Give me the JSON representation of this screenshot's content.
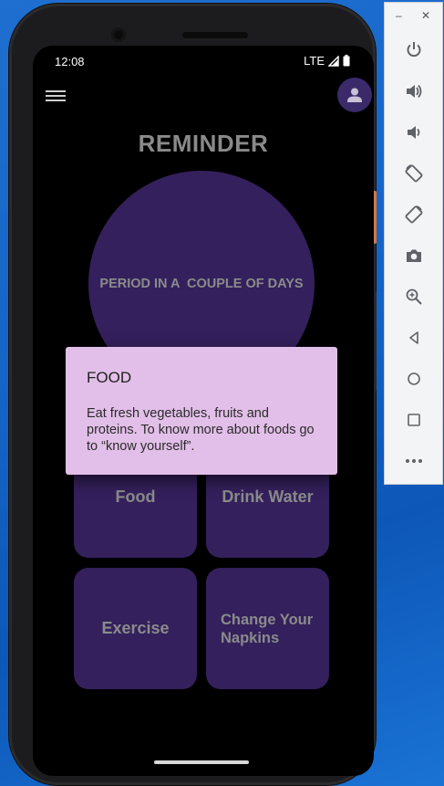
{
  "status_bar": {
    "time": "12:08",
    "network": "LTE"
  },
  "app": {
    "title": "REMINDER",
    "circle_text": "PERIOD IN A  COUPLE OF DAYS",
    "tiles": [
      {
        "label": "Food"
      },
      {
        "label": "Drink Water"
      },
      {
        "label": "Exercise"
      },
      {
        "label": "Change Your\nNapkins"
      }
    ]
  },
  "dialog": {
    "title": "FOOD",
    "body": "Eat fresh vegetables, fruits and proteins. To know more about foods go to “know yourself”."
  },
  "toolbar": {
    "minimize_label": "–",
    "close_label": "✕",
    "buttons": [
      "power-icon",
      "volume-up-icon",
      "volume-down-icon",
      "rotate-left-icon",
      "rotate-right-icon",
      "camera-icon",
      "zoom-icon",
      "back-icon",
      "home-icon",
      "overview-icon",
      "more-icon"
    ]
  },
  "colors": {
    "accent_purple": "#34205c",
    "dialog_bg": "#e2bfe8",
    "screen_bg": "#000000",
    "desktop_bg": "#1565c8"
  }
}
